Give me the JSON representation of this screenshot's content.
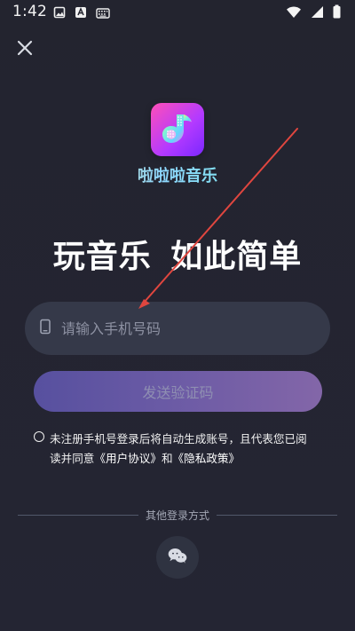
{
  "status_bar": {
    "time": "1:42",
    "left_icons": [
      "image-icon",
      "text-a-icon",
      "keyboard-icon"
    ],
    "right_icons": [
      "wifi-icon",
      "signal-icon",
      "battery-icon"
    ]
  },
  "top_bar": {
    "close_icon": "close-icon"
  },
  "app": {
    "name": "啦啦啦音乐",
    "slogan": "玩音乐 如此简单"
  },
  "phone_login": {
    "placeholder": "请输入手机号码",
    "send_code_label": "发送验证码"
  },
  "agreement": {
    "line1": "未注册手机号登录后将自动生成账号，且代表您已阅",
    "line2_prefix": "读并同意",
    "user_agreement": "《用户协议》",
    "connector": "和",
    "privacy_policy": "《隐私政策》"
  },
  "other_login": {
    "label": "其他登录方式",
    "wechat_icon": "wechat-icon"
  },
  "colors": {
    "background": "#23242f",
    "field_background": "#353949",
    "button_start": "#57509f",
    "button_end": "#8366a8",
    "annotation_arrow": "#e0463f"
  }
}
